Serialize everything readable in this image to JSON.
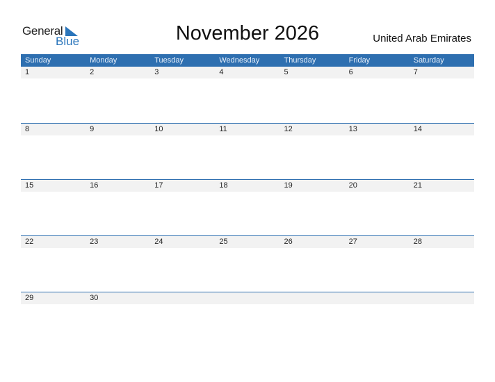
{
  "logo": {
    "word1": "General",
    "word2": "Blue"
  },
  "header": {
    "title": "November 2026",
    "country": "United Arab Emirates"
  },
  "calendar": {
    "weekdays": [
      "Sunday",
      "Monday",
      "Tuesday",
      "Wednesday",
      "Thursday",
      "Friday",
      "Saturday"
    ],
    "weeks": [
      [
        "1",
        "2",
        "3",
        "4",
        "5",
        "6",
        "7"
      ],
      [
        "8",
        "9",
        "10",
        "11",
        "12",
        "13",
        "14"
      ],
      [
        "15",
        "16",
        "17",
        "18",
        "19",
        "20",
        "21"
      ],
      [
        "22",
        "23",
        "24",
        "25",
        "26",
        "27",
        "28"
      ],
      [
        "29",
        "30",
        "",
        "",
        "",
        "",
        ""
      ]
    ]
  },
  "colors": {
    "accent": "#2e6fb0",
    "logo_blue": "#2a75bb",
    "day_row_bg": "#f2f2f2"
  }
}
